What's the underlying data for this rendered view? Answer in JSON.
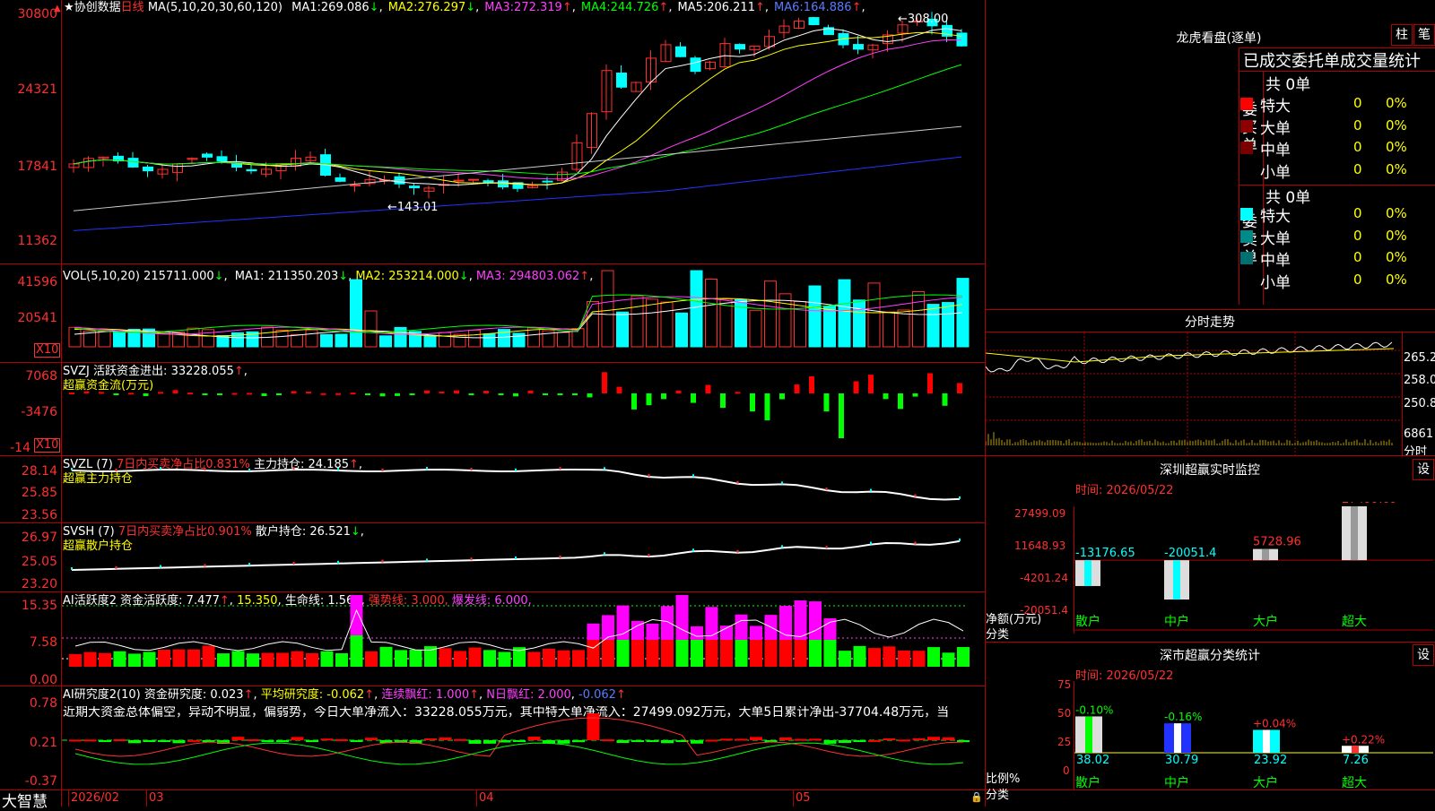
{
  "price_panel": {
    "title_star": "★",
    "stock_name": "协创数据",
    "period": "日线",
    "ma_label": "MA(5,10,20,30,60,120)",
    "ma_values": [
      {
        "label": "MA1:",
        "value": "269.086",
        "arrow": "↓",
        "color": "#ffffff"
      },
      {
        "label": "MA2:",
        "value": "276.297",
        "arrow": "↓",
        "color": "#ffff00"
      },
      {
        "label": "MA3:",
        "value": "272.319",
        "arrow": "↑",
        "color": "#ff40ff"
      },
      {
        "label": "MA4:",
        "value": "244.726",
        "arrow": "↑",
        "color": "#00ff00"
      },
      {
        "label": "MA5:",
        "value": "206.211",
        "arrow": "↑",
        "color": "#ffffff"
      },
      {
        "label": "MA6:",
        "value": "164.886",
        "arrow": "↑",
        "color": "#5a7bff"
      }
    ],
    "y_ticks": [
      "30800",
      "24321",
      "17841",
      "11362"
    ],
    "high_label": "308.00",
    "low_label": "143.01"
  },
  "vol_panel": {
    "title": "VOL(5,10,20)",
    "value": "215711.000",
    "value_arrow": "↓",
    "mas": [
      {
        "label": "MA1:",
        "value": "211350.203",
        "arrow": "↓",
        "color": "#ffffff"
      },
      {
        "label": "MA2:",
        "value": "253214.000",
        "arrow": "↓",
        "color": "#ffff00"
      },
      {
        "label": "MA3:",
        "value": "294803.062",
        "arrow": "↑",
        "color": "#ff40ff"
      }
    ],
    "y_ticks": [
      "41596",
      "20541"
    ],
    "unit": "X10"
  },
  "svzj_panel": {
    "title": "SVZJ",
    "label": "活跃资金进出:",
    "value": "33228.055",
    "arrow": "↑",
    "sublabel": "超赢资金流(万元)",
    "y_ticks": [
      "7068",
      "-3476",
      "-14"
    ],
    "unit": "X10"
  },
  "svzl_panel": {
    "title": "SVZL (7)",
    "ratio_label": "7日内买卖净占比0.831%",
    "hold_label": "主力持仓:",
    "hold_value": "24.185",
    "arrow": "↑",
    "sublabel": "超赢主力持仓",
    "y_ticks": [
      "28.14",
      "25.85",
      "23.56"
    ]
  },
  "svsh_panel": {
    "title": "SVSH (7)",
    "ratio_label": "7日内买卖净占比0.901%",
    "hold_label": "散户持仓:",
    "hold_value": "26.521",
    "arrow": "↓",
    "sublabel": "超赢散户持仓",
    "y_ticks": [
      "26.97",
      "25.05",
      "23.20"
    ]
  },
  "ai_active_panel": {
    "title": "AI活跃度2",
    "label": "资金活跃度:",
    "value": "7.477",
    "arrow": "↑",
    "v2": "15.350",
    "life_label": "生命线:",
    "life_value": "1.560",
    "strong_label": "强势线:",
    "strong_value": "3.000",
    "burst_label": "爆发线:",
    "burst_value": "6.000",
    "y_ticks": [
      "15.35",
      "7.58",
      "0.00"
    ]
  },
  "ai_research_panel": {
    "title": "AI研究度2(10)",
    "label": "资金研究度:",
    "value": "0.023",
    "arrow": "↑",
    "avg_label": "平均研究度:",
    "avg_value": "-0.062",
    "avg_arrow": "↑",
    "red_label": "连续飘红:",
    "red_value": "1.000",
    "red_arrow": "↑",
    "n_label": "N日飘红:",
    "n_value": "2.000",
    "last_value": "-0.062",
    "commentary": "近期大资金总体偏空，异动不明显，偏弱势，今日大单净流入：33228.055万元，其中特大单净流入：27499.092万元，大单5日累计净出-37704.48万元，当",
    "y_ticks": [
      "0.78",
      "0.21",
      "-0.37"
    ]
  },
  "bottom_bar": {
    "brand": "大智慧",
    "dates": [
      "2026/02",
      "03",
      "04",
      "05"
    ]
  },
  "dragon_tiger": {
    "title": "龙虎看盘(逐单)",
    "btn_bar": "柱",
    "btn_pen": "笔",
    "subtitle": "已成交委托单成交量统计",
    "buy": {
      "count": "共 0单",
      "vlabel": "委买单",
      "rows": [
        {
          "label": "特大",
          "value": "0",
          "pct": "0%",
          "color": "#ff0000"
        },
        {
          "label": "大单",
          "value": "0",
          "pct": "0%",
          "color": "#8b0000"
        },
        {
          "label": "中单",
          "value": "0",
          "pct": "0%",
          "color": "#7a0000"
        },
        {
          "label": "小单",
          "value": "0",
          "pct": "0%",
          "color": ""
        }
      ]
    },
    "sell": {
      "count": "共 0单",
      "vlabel": "委卖单",
      "rows": [
        {
          "label": "特大",
          "value": "0",
          "pct": "0%",
          "color": "#00ffff"
        },
        {
          "label": "大单",
          "value": "0",
          "pct": "0%",
          "color": "#008b8b"
        },
        {
          "label": "中单",
          "value": "0",
          "pct": "0%",
          "color": "#007070"
        },
        {
          "label": "小单",
          "value": "0",
          "pct": "0%",
          "color": ""
        }
      ]
    }
  },
  "intraday": {
    "title": "分时走势",
    "prices": [
      "265.2",
      "258.0",
      "250.8"
    ],
    "volume": "6861",
    "unit": "分时"
  },
  "sz_monitor": {
    "title": "深圳超赢实时监控",
    "settings": "设",
    "time": "时间: 2026/05/22",
    "y_ticks": [
      "27499.09",
      "11648.93",
      "-4201.24",
      "-20051.4"
    ],
    "y_label": "净额(万元)",
    "x_label": "分类",
    "categories": [
      "散户",
      "中户",
      "大户",
      "超大"
    ],
    "values": [
      "-13176.65",
      "-20051.4",
      "5728.96",
      "27499.09"
    ]
  },
  "sz_classify": {
    "title": "深市超赢分类统计",
    "settings": "设",
    "time": "时间: 2026/05/22",
    "y_ticks": [
      "75",
      "50",
      "25",
      "0"
    ],
    "y_label": "比例%",
    "x_label": "分类",
    "categories": [
      "散户",
      "中户",
      "大户",
      "超大"
    ],
    "changes": [
      "-0.10%",
      "-0.16%",
      "+0.04%",
      "+0.22%"
    ],
    "values": [
      "38.02",
      "30.79",
      "23.92",
      "7.26"
    ]
  },
  "chart_data": [
    {
      "type": "candlestick",
      "title": "协创数据 日线",
      "ylim": [
        11362,
        30800
      ],
      "y_ticks": [
        30800,
        24321,
        17841,
        11362
      ],
      "annotations": [
        {
          "text": "308.00"
        },
        {
          "text": "143.01"
        }
      ]
    },
    {
      "type": "bar",
      "title": "深圳超赢实时监控",
      "categories": [
        "散户",
        "中户",
        "大户",
        "超大"
      ],
      "values": [
        -13176.65,
        -20051.4,
        5728.96,
        27499.09
      ],
      "ylabel": "净额(万元)",
      "xlabel": "分类",
      "ylim": [
        -20051.4,
        27499.09
      ]
    },
    {
      "type": "bar",
      "title": "深市超赢分类统计",
      "categories": [
        "散户",
        "中户",
        "大户",
        "超大"
      ],
      "values": [
        38.02,
        30.79,
        23.92,
        7.26
      ],
      "ylabel": "比例%",
      "xlabel": "分类",
      "ylim": [
        0,
        75
      ]
    }
  ]
}
